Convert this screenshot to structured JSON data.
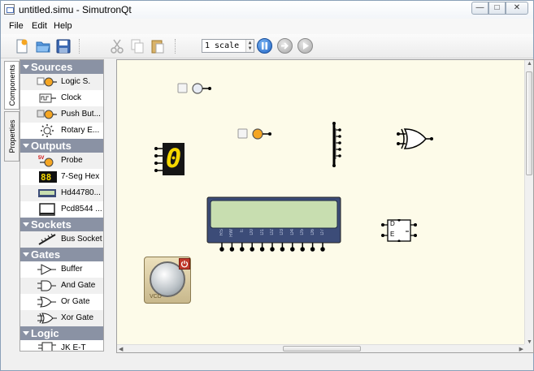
{
  "window": {
    "title": "untitled.simu - SimutronQt",
    "min_glyph": "—",
    "max_glyph": "□",
    "close_glyph": "✕"
  },
  "menu": {
    "file": "File",
    "edit": "Edit",
    "help": "Help"
  },
  "toolbar": {
    "speed_value": "1 scale",
    "icons": [
      "new-file-icon",
      "open-folder-icon",
      "save-icon",
      "cut-icon",
      "copy-icon",
      "paste-icon",
      "pause-icon",
      "step-icon",
      "play-icon"
    ]
  },
  "side_tabs": {
    "components": "Components",
    "properties": "Properties"
  },
  "categories": {
    "sources": {
      "label": "Sources",
      "items": [
        "Logic S.",
        "Clock",
        "Push But...",
        "Rotary E..."
      ]
    },
    "outputs": {
      "label": "Outputs",
      "items": [
        "Probe",
        "7-Seg Hex",
        "Hd44780...",
        "Pcd8544 ..."
      ]
    },
    "sockets": {
      "label": "Sockets",
      "items": [
        "Bus Socket"
      ]
    },
    "gates": {
      "label": "Gates",
      "items": [
        "Buffer",
        "And Gate",
        "Or Gate",
        "Xor Gate"
      ]
    },
    "logic": {
      "label": "Logic",
      "items": [
        "JK E-T"
      ]
    }
  },
  "canvas": {
    "seven_seg_digit": "0",
    "lcd_pins": [
      "RS",
      "RW",
      "E",
      "D0",
      "D1",
      "D2",
      "D3",
      "D4",
      "D5",
      "D6",
      "D7"
    ],
    "dff_labels": [
      "D",
      "E"
    ],
    "vcd_label": "VCD",
    "colors": {
      "canvas_bg": "#fdfbe9",
      "lcd_body": "#3c4c78",
      "lcd_screen": "#c8deb0",
      "probe_orange": "#f5a623",
      "seg_yellow": "#f5d800"
    }
  }
}
